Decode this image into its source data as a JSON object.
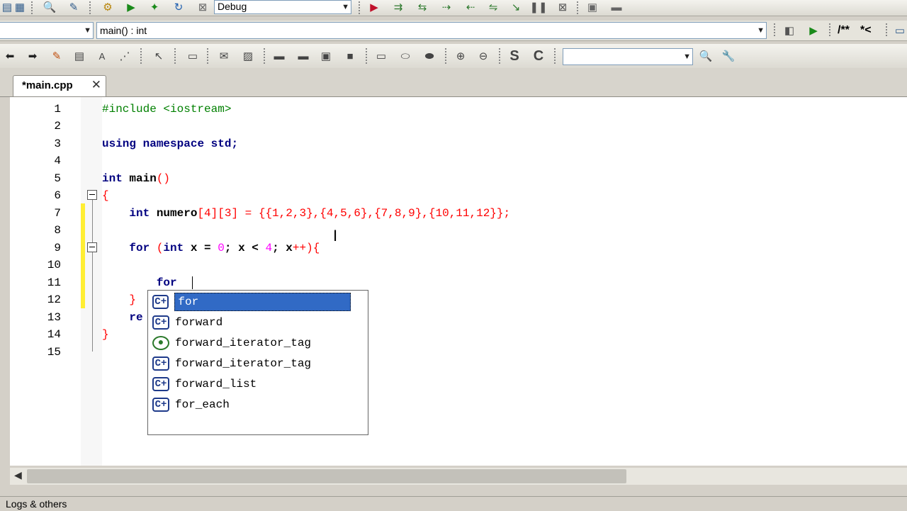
{
  "toolbar": {
    "build_target": "Debug",
    "scope": "main() : int",
    "search_value": "",
    "comment_labels": [
      "/**",
      "*<"
    ]
  },
  "tab": {
    "label": "*main.cpp",
    "close": "✕"
  },
  "line_numbers": [
    "1",
    "2",
    "3",
    "4",
    "5",
    "6",
    "7",
    "8",
    "9",
    "10",
    "11",
    "12",
    "13",
    "14",
    "15"
  ],
  "code": {
    "l1_a": "#include <iostream>",
    "l3_kw1": "using",
    "l3_kw2": "namespace",
    "l3_rest": " std;",
    "l5_kw": "int",
    "l5_name": " main",
    "l5_par": "()",
    "l6": "{",
    "l7_kw": "int",
    "l7_name": " numero",
    "l7_rest": "[4][3] = {{1,2,3},{4,5,6},{7,8,9},{10,11,12}};",
    "l9_kw": "for",
    "l9_a": " (",
    "l9_kw2": "int",
    "l9_b": " x = ",
    "l9_c": "0",
    "l9_d": "; x < ",
    "l9_e": "4",
    "l9_f": "; x",
    "l9_g": "++){",
    "l11": "for",
    "l12": "}",
    "l13": "re",
    "l14": "}"
  },
  "autocomplete": {
    "items": [
      {
        "label": "for",
        "icon": "cpp-icon",
        "selected": true
      },
      {
        "label": "forward",
        "icon": "cpp-icon"
      },
      {
        "label": "forward_iterator_tag",
        "icon": "class-icon"
      },
      {
        "label": "forward_iterator_tag",
        "icon": "cpp-icon"
      },
      {
        "label": "forward_list",
        "icon": "cpp-icon"
      },
      {
        "label": "for_each",
        "icon": "cpp-icon"
      }
    ]
  },
  "status": {
    "panel_label": "Logs & others"
  }
}
